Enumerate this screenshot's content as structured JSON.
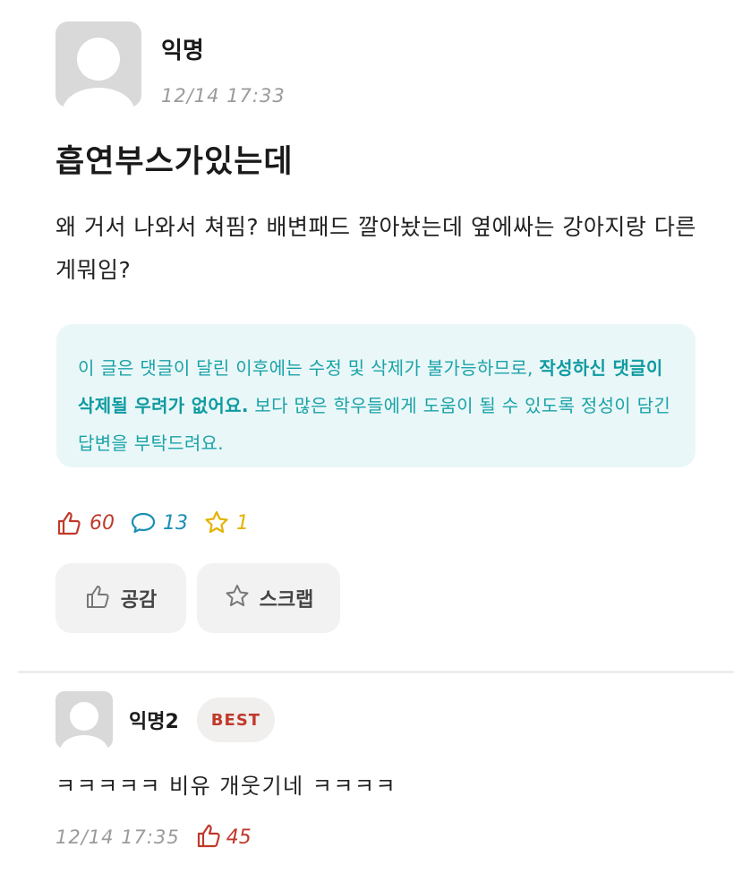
{
  "post": {
    "author": "익명",
    "time": "12/14 17:33",
    "title": "흡연부스가있는데",
    "body": "왜 거서 나와서 쳐핌? 배변패드 깔아놨는데 옆에싸는 강아지랑 다른게뭐임?"
  },
  "notice": {
    "text_1": "이 글은 댓글이 달린 이후에는 수정 및 삭제가 불가능하므로, ",
    "strong": "작성하신 댓글이 삭제될 우려가 없어요.",
    "text_2": " 보다 많은 학우들에게 도움이 될 수 있도록 정성이 담긴 답변을 부탁드려요."
  },
  "stats": {
    "likes": "60",
    "comments": "13",
    "scraps": "1"
  },
  "actions": {
    "like_label": "공감",
    "scrap_label": "스크랩"
  },
  "comment": {
    "author": "익명2",
    "badge": "BEST",
    "body": "ㅋㅋㅋㅋㅋ 비유 개웃기네 ㅋㅋㅋㅋ",
    "time": "12/14 17:35",
    "likes": "45"
  },
  "colors": {
    "like": "#c0392b",
    "comment": "#1a8fb5",
    "scrap": "#e3b300",
    "notice_bg": "#eaf7f8",
    "notice_text": "#1aa3a8"
  },
  "icons": {
    "like": "thumbs-up-icon",
    "comment": "speech-bubble-icon",
    "scrap": "star-icon",
    "avatar": "default-avatar-icon"
  }
}
